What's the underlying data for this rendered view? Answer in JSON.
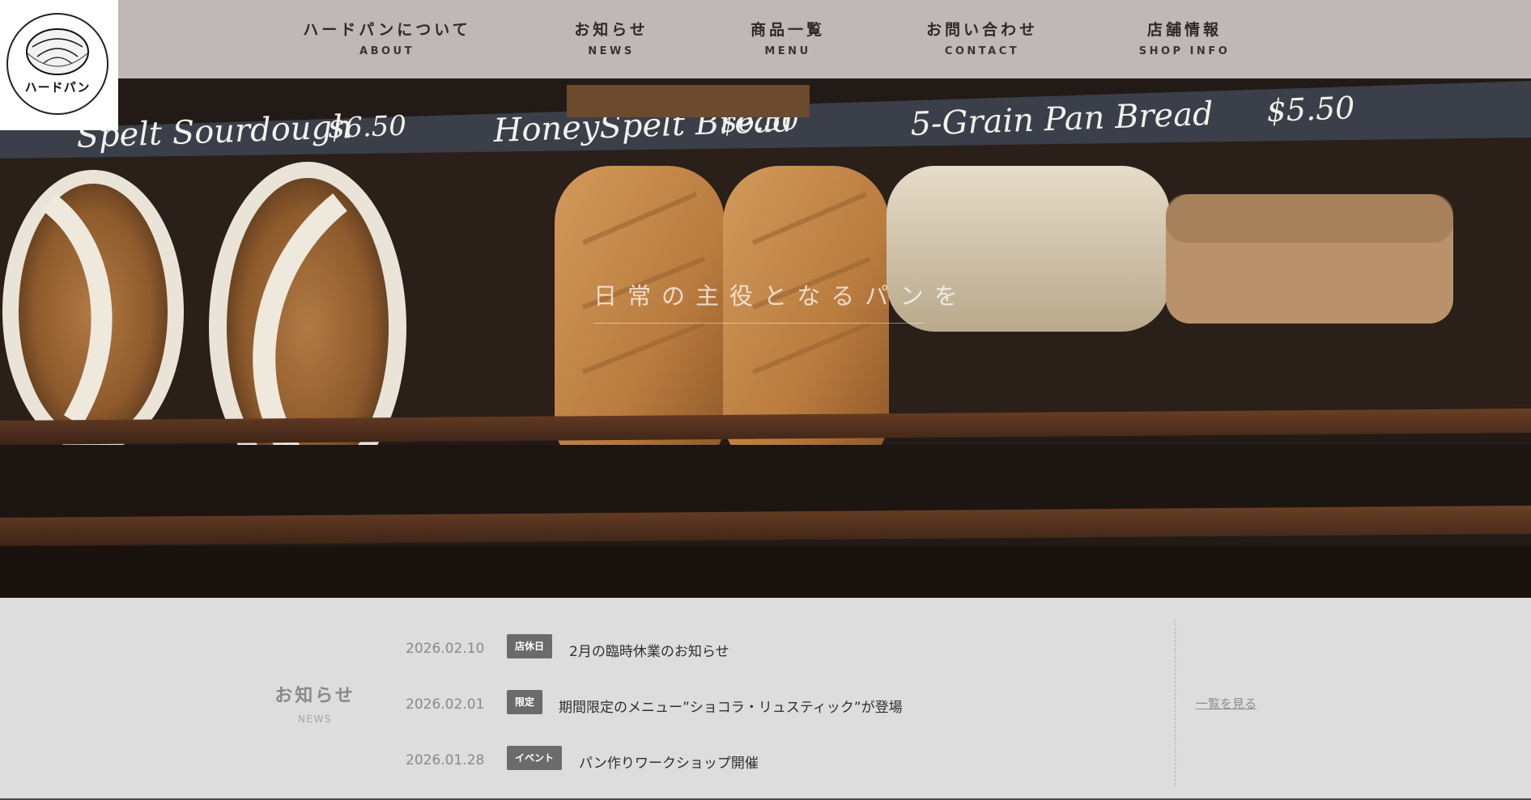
{
  "brand": {
    "logo_text": "ハードパン"
  },
  "nav": [
    {
      "jp": "ハードパンについて",
      "en": "ABOUT"
    },
    {
      "jp": "お知らせ",
      "en": "NEWS"
    },
    {
      "jp": "商品一覧",
      "en": "MENU"
    },
    {
      "jp": "お問い合わせ",
      "en": "CONTACT"
    },
    {
      "jp": "店舗情報",
      "en": "SHOP INFO"
    }
  ],
  "hero": {
    "catch": "日常の主役となるパンを",
    "chalkboard": [
      {
        "name": "Spelt Sourdough",
        "price": "$6.50"
      },
      {
        "name": "HoneySpelt Bread",
        "price": "$6.50"
      },
      {
        "name": "5-Grain Pan Bread",
        "price": "$5.50"
      }
    ]
  },
  "news": {
    "heading_jp": "お知らせ",
    "heading_en": "NEWS",
    "more_label": "一覧を見る",
    "items": [
      {
        "date": "2026.02.10",
        "badge": "店休日",
        "title": "2月の臨時休業のお知らせ"
      },
      {
        "date": "2026.02.01",
        "badge": "限定",
        "title": "期間限定のメニュー”ショコラ・リュスティック”が登場"
      },
      {
        "date": "2026.01.28",
        "badge": "イベント",
        "title": "パン作りワークショップ開催"
      }
    ]
  },
  "colors": {
    "header_bg": "#ccc5c5",
    "news_bg": "#dedddd",
    "badge_bg": "#6b6b6b"
  }
}
